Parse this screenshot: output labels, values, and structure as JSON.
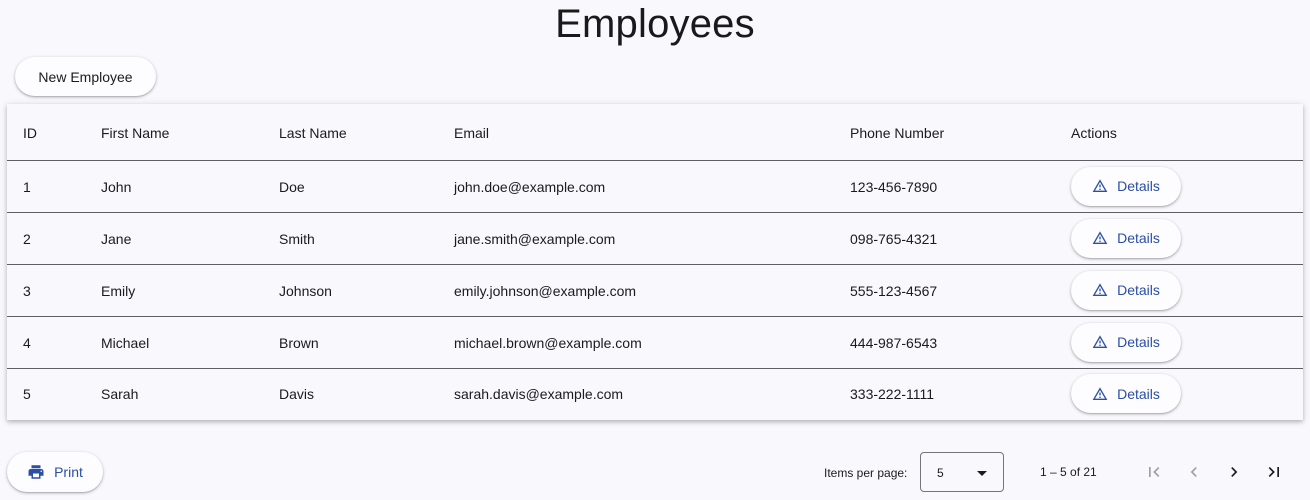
{
  "page": {
    "title": "Employees"
  },
  "toolbar": {
    "new_label": "New Employee"
  },
  "table": {
    "columns": [
      "ID",
      "First Name",
      "Last Name",
      "Email",
      "Phone Number",
      "Actions"
    ],
    "rows": [
      {
        "id": "1",
        "first": "John",
        "last": "Doe",
        "email": "john.doe@example.com",
        "phone": "123-456-7890",
        "action": "Details"
      },
      {
        "id": "2",
        "first": "Jane",
        "last": "Smith",
        "email": "jane.smith@example.com",
        "phone": "098-765-4321",
        "action": "Details"
      },
      {
        "id": "3",
        "first": "Emily",
        "last": "Johnson",
        "email": "emily.johnson@example.com",
        "phone": "555-123-4567",
        "action": "Details"
      },
      {
        "id": "4",
        "first": "Michael",
        "last": "Brown",
        "email": "michael.brown@example.com",
        "phone": "444-987-6543",
        "action": "Details"
      },
      {
        "id": "5",
        "first": "Sarah",
        "last": "Davis",
        "email": "sarah.davis@example.com",
        "phone": "333-222-1111",
        "action": "Details"
      }
    ]
  },
  "footer": {
    "print_label": "Print",
    "items_per_page_label": "Items per page:",
    "items_per_page_value": "5",
    "range_label": "1 – 5 of 21"
  },
  "icons": {
    "details": "warning-triangle-icon",
    "print": "printer-icon",
    "first_page": "first-page-icon",
    "prev_page": "chevron-left-icon",
    "next_page": "chevron-right-icon",
    "last_page": "last-page-icon"
  },
  "colors": {
    "accent": "#2a4fa3",
    "background": "#f9f8fd",
    "disabled": "#9e9ea4"
  }
}
